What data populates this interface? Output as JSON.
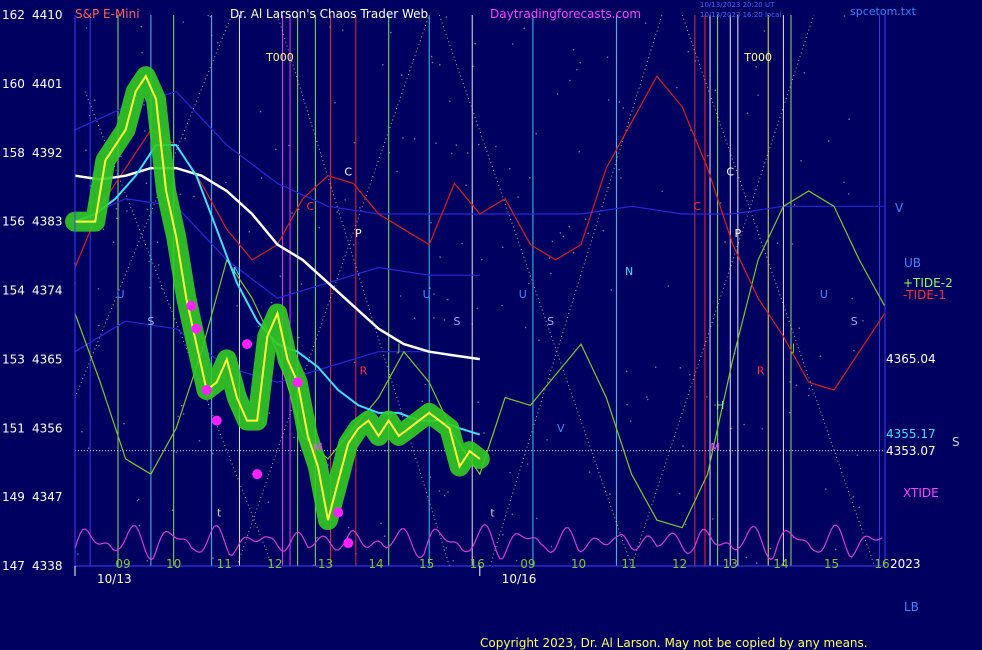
{
  "header": {
    "symbol": "S&P E-Mini",
    "author": "Dr. Al Larson's Chaos Trader Web",
    "site": "Daytradingforecasts.com",
    "ts_line1": "10/13/2023 20:20 UT",
    "ts_line2": "10/13/2023 16:20 local",
    "file": "spcetom.txt"
  },
  "footer": {
    "copyright": "Copyright 2023, Dr. Al Larson. May not be copied by any means."
  },
  "colors": {
    "background": "#000060",
    "price": "#ffff40",
    "highlight": "#33cc22",
    "fast_ma": "#40e0ff",
    "slow_ma": "#ffffff",
    "tide_plus": "#7ec832",
    "tide_minus": "#d42020",
    "xtide": "#d040d0",
    "band": "#2828d8",
    "magenta_dot": "#ff20ff",
    "label_left": "#ff6060",
    "label_mid": "#ffffff",
    "label_site": "#ff44ff",
    "label_ts": "#4466ff",
    "label_file": "#3388ff",
    "grid_dots": "#c8c8c8",
    "line_tide_label_plus": "#90ff60",
    "line_tide_label_minus": "#ff3030"
  },
  "chart_data": {
    "type": "line",
    "y_left_labels": [
      "162",
      "160",
      "158",
      "156",
      "154",
      "153",
      "151",
      "149",
      "147"
    ],
    "y_right_labels": [
      "4410",
      "4401",
      "4392",
      "4383",
      "4374",
      "4365",
      "4356",
      "4347",
      "4338"
    ],
    "y_ticks": [
      4410,
      4401,
      4392,
      4383,
      4374,
      4365,
      4356,
      4347,
      4338
    ],
    "ylim": [
      4338,
      4410
    ],
    "x_hours": [
      "09",
      "10",
      "11",
      "12",
      "13",
      "14",
      "15",
      "16",
      "09",
      "10",
      "11",
      "12",
      "13",
      "14",
      "15",
      "16"
    ],
    "x_dates": [
      "10/13",
      "10/16"
    ],
    "x_date_hours": [
      0,
      8
    ],
    "year": "2023",
    "right_labels": {
      "price_end": "4365.04",
      "fast_ma_end": "4355.17",
      "last_price": "4353.07",
      "S": "S"
    },
    "legend": {
      "V": "V",
      "UB": "UB",
      "tide_plus": "+TIDE-2",
      "tide_minus": "-TIDE-1",
      "xtide": "XTIDE",
      "LB": "LB"
    },
    "markers": [
      {
        "t": "T000",
        "x": 4.05,
        "y": 4404,
        "c": "#ffff80"
      },
      {
        "t": "T000",
        "x": 13.5,
        "y": 4404,
        "c": "#ffff80"
      },
      {
        "t": "C",
        "x": 5.4,
        "y": 4389,
        "c": "#ffffff"
      },
      {
        "t": "C",
        "x": 12.95,
        "y": 4389,
        "c": "#ffffff"
      },
      {
        "t": "C",
        "x": 4.65,
        "y": 4384.5,
        "c": "#ff3030"
      },
      {
        "t": "C",
        "x": 12.3,
        "y": 4384.5,
        "c": "#ff3030"
      },
      {
        "t": "P",
        "x": 5.6,
        "y": 4381,
        "c": "#ffffff"
      },
      {
        "t": "P",
        "x": 13.1,
        "y": 4381,
        "c": "#ffffff"
      },
      {
        "t": "N",
        "x": 3.2,
        "y": 4376,
        "c": "#40e0ff"
      },
      {
        "t": "N",
        "x": 10.95,
        "y": 4376,
        "c": "#40e0ff"
      },
      {
        "t": "U",
        "x": 0.9,
        "y": 4373,
        "c": "#4488ff"
      },
      {
        "t": "U",
        "x": 6.95,
        "y": 4373,
        "c": "#4488ff"
      },
      {
        "t": "U",
        "x": 8.85,
        "y": 4373,
        "c": "#4488ff"
      },
      {
        "t": "U",
        "x": 14.8,
        "y": 4373,
        "c": "#4488ff"
      },
      {
        "t": "S",
        "x": 1.5,
        "y": 4369.5,
        "c": "#aaaaff"
      },
      {
        "t": "S",
        "x": 7.55,
        "y": 4369.5,
        "c": "#aaaaff"
      },
      {
        "t": "S",
        "x": 9.4,
        "y": 4369.5,
        "c": "#aaaaff"
      },
      {
        "t": "S",
        "x": 15.4,
        "y": 4369.5,
        "c": "#aaaaff"
      },
      {
        "t": "J",
        "x": 6.4,
        "y": 4366,
        "c": "#7ec832"
      },
      {
        "t": "J",
        "x": 14.2,
        "y": 4366,
        "c": "#7ec832"
      },
      {
        "t": "R",
        "x": 5.7,
        "y": 4363,
        "c": "#ff3030"
      },
      {
        "t": "R",
        "x": 13.55,
        "y": 4363,
        "c": "#ff3030"
      },
      {
        "t": "H",
        "x": 12.75,
        "y": 4358.5,
        "c": "#80ff80"
      },
      {
        "t": "M",
        "x": 4.8,
        "y": 4353,
        "c": "#ff44ff"
      },
      {
        "t": "M",
        "x": 12.65,
        "y": 4353,
        "c": "#ff44ff"
      },
      {
        "t": "t",
        "x": 2.85,
        "y": 4344.5,
        "c": "#cccccc"
      },
      {
        "t": "t",
        "x": 8.25,
        "y": 4344.5,
        "c": "#cccccc"
      },
      {
        "t": "V",
        "x": 9.6,
        "y": 4355.5,
        "c": "#4488ff"
      }
    ],
    "vertical_lines": [
      {
        "x": 0.3,
        "c": "#4040ff"
      },
      {
        "x": 0.85,
        "c": "#90ff60"
      },
      {
        "x": 1.5,
        "c": "#40e0ff"
      },
      {
        "x": 1.95,
        "c": "#90ff60"
      },
      {
        "x": 2.7,
        "c": "#40e0ff"
      },
      {
        "x": 3.25,
        "c": "#ffffff"
      },
      {
        "x": 4.1,
        "c": "#ff40ff"
      },
      {
        "x": 4.25,
        "c": "#ff40ff"
      },
      {
        "x": 4.4,
        "c": "#90ff60"
      },
      {
        "x": 4.75,
        "c": "#90ff60"
      },
      {
        "x": 5.05,
        "c": "#ff3030"
      },
      {
        "x": 5.55,
        "c": "#ff3030"
      },
      {
        "x": 6.2,
        "c": "#90ff60"
      },
      {
        "x": 7.0,
        "c": "#40e0ff"
      },
      {
        "x": 7.85,
        "c": "#ffffff"
      },
      {
        "x": 9.05,
        "c": "#40e0ff"
      },
      {
        "x": 10.7,
        "c": "#40e0ff"
      },
      {
        "x": 12.25,
        "c": "#ff3030"
      },
      {
        "x": 12.45,
        "c": "#ff3030"
      },
      {
        "x": 12.55,
        "c": "#ffffff"
      },
      {
        "x": 12.7,
        "c": "#90ff60"
      },
      {
        "x": 12.95,
        "c": "#ffffff"
      },
      {
        "x": 13.1,
        "c": "#ffffff"
      },
      {
        "x": 13.7,
        "c": "#ffff60"
      },
      {
        "x": 14.0,
        "c": "#ffffff"
      },
      {
        "x": 14.15,
        "c": "#90ff60"
      },
      {
        "x": 15.9,
        "c": "#4040ff"
      }
    ],
    "xtide_base": 4338.5,
    "xtide_amp": 3.5,
    "series": [
      {
        "key": "price",
        "name": "S&P E-Mini",
        "x": [
          0,
          0.2,
          0.4,
          0.6,
          0.8,
          1.0,
          1.2,
          1.4,
          1.6,
          1.8,
          2.0,
          2.2,
          2.4,
          2.6,
          2.8,
          3.0,
          3.2,
          3.4,
          3.6,
          3.8,
          4.0,
          4.2,
          4.4,
          4.6,
          4.8,
          5.0,
          5.2,
          5.4,
          5.6,
          5.8,
          6.0,
          6.2,
          6.4,
          6.6,
          6.8,
          7.0,
          7.2,
          7.4,
          7.6,
          7.8,
          8.0
        ],
        "y": [
          4383,
          4383,
          4383,
          4391,
          4393,
          4395,
          4400,
          4402,
          4399,
          4387,
          4381,
          4373,
          4367,
          4361,
          4362,
          4365,
          4360,
          4357,
          4357,
          4368,
          4371,
          4365,
          4362,
          4355,
          4351,
          4344,
          4349,
          4354,
          4356,
          4357,
          4355,
          4357,
          4355,
          4356,
          4357,
          4358,
          4357,
          4356,
          4351,
          4353,
          4352
        ]
      },
      {
        "key": "fast_ma",
        "name": "fast average",
        "x": [
          0,
          0.4,
          0.8,
          1.2,
          1.6,
          2.0,
          2.4,
          2.8,
          3.2,
          3.6,
          4.0,
          4.4,
          4.8,
          5.2,
          5.6,
          6.0,
          6.4,
          6.8,
          7.2,
          7.6,
          8.0
        ],
        "y": [
          4383,
          4384,
          4386,
          4389,
          4393,
          4393,
          4389,
          4382,
          4375,
          4370,
          4367,
          4366,
          4364,
          4361,
          4359,
          4358,
          4358,
          4357,
          4357,
          4356,
          4355.17
        ]
      },
      {
        "key": "slow_ma",
        "name": "slow average",
        "x": [
          0,
          0.5,
          1.0,
          1.5,
          2.0,
          2.5,
          3.0,
          3.5,
          4.0,
          4.5,
          5.0,
          5.5,
          6.0,
          6.5,
          7.0,
          7.5,
          8.0
        ],
        "y": [
          4389,
          4388.5,
          4389,
          4390,
          4390,
          4389,
          4387,
          4384,
          4380,
          4378,
          4375,
          4372,
          4369,
          4367,
          4366,
          4365.5,
          4365.04
        ]
      },
      {
        "key": "tide_plus",
        "name": "+TIDE-2",
        "x": [
          0,
          0.5,
          1.0,
          1.5,
          2.0,
          2.5,
          3.0,
          3.5,
          4.0,
          4.5,
          5.0,
          5.5,
          6.0,
          6.5,
          7.0,
          7.5,
          8.0,
          8.5,
          9.0,
          9.5,
          10.0,
          10.5,
          11.0,
          11.5,
          12.0,
          12.5,
          13.0,
          13.5,
          14.0,
          14.5,
          15.0,
          15.5,
          16.0
        ],
        "y": [
          4371,
          4362,
          4352,
          4350,
          4356,
          4366,
          4378,
          4373,
          4366,
          4355,
          4352,
          4356,
          4360,
          4366,
          4362,
          4355,
          4350,
          4360,
          4359,
          4363,
          4367,
          4360,
          4350,
          4344,
          4343,
          4350,
          4365,
          4378,
          4385,
          4387,
          4385,
          4378,
          4372
        ]
      },
      {
        "key": "tide_minus",
        "name": "-TIDE-1",
        "x": [
          0,
          0.5,
          1.0,
          1.5,
          2.0,
          2.5,
          3.0,
          3.5,
          4.0,
          4.5,
          5.0,
          5.5,
          6.0,
          6.5,
          7.0,
          7.5,
          8.0,
          8.5,
          9.0,
          9.5,
          10.0,
          10.5,
          11.0,
          11.5,
          12.0,
          12.5,
          13.0,
          13.5,
          14.0,
          14.5,
          15.0,
          15.5,
          16.0
        ],
        "y": [
          4377,
          4385,
          4390,
          4395,
          4393,
          4388,
          4382,
          4378,
          4380,
          4386,
          4389,
          4388,
          4384,
          4382,
          4380,
          4388,
          4384,
          4386,
          4380,
          4378,
          4380,
          4390,
          4396,
          4402,
          4398,
          4390,
          4380,
          4373,
          4368,
          4362,
          4361,
          4366,
          4371
        ]
      },
      {
        "key": "band_top",
        "name": "UB",
        "x": [
          0,
          1.0,
          2.0,
          3.0,
          4.0,
          5.0,
          6.0,
          7.0,
          8.0,
          9.0,
          10.0,
          11.0,
          12.0,
          13.0,
          14.0,
          15.0,
          16.0
        ],
        "y": [
          4395,
          4398,
          4400,
          4393,
          4388,
          4385,
          4384,
          4384,
          4384,
          4384,
          4384,
          4385,
          4384,
          4384,
          4385,
          4385,
          4385
        ]
      },
      {
        "key": "band_mid",
        "name": "band middle",
        "x": [
          0,
          1.0,
          2.0,
          3.0,
          4.0,
          5.0,
          6.0,
          7.0,
          8.0
        ],
        "y": [
          4383,
          4386,
          4385,
          4378,
          4373,
          4375,
          4377,
          4376,
          4376
        ]
      },
      {
        "key": "band_low",
        "name": "LB",
        "x": [
          0,
          1.0,
          2.0,
          3.0,
          4.0,
          5.0,
          6.0,
          7.0,
          8.0
        ],
        "y": [
          4366,
          4370,
          4369,
          4364,
          4362,
          4364,
          4366,
          4366,
          4365
        ]
      }
    ]
  }
}
